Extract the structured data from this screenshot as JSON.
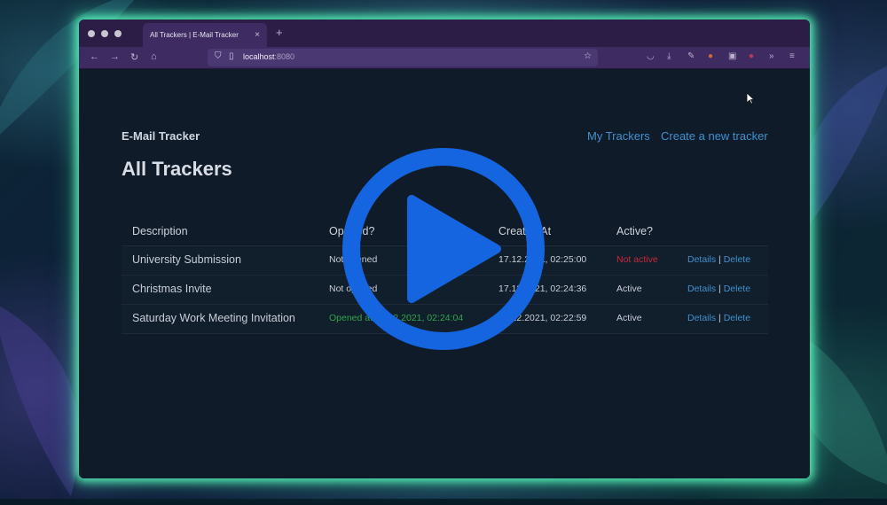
{
  "browser": {
    "tab_title": "All Trackers | E-Mail Tracker",
    "tab_close": "×",
    "new_tab": "+",
    "url_host": "localhost",
    "url_port": ":8080"
  },
  "header": {
    "brand": "E-Mail Tracker",
    "links": [
      "My Trackers",
      "Create a new tracker"
    ]
  },
  "page": {
    "title": "All Trackers"
  },
  "table": {
    "columns": [
      "Description",
      "Opened?",
      "Created At",
      "Active?"
    ],
    "rows": [
      {
        "description": "University Submission",
        "opened": "Not opened",
        "created_at": "17.12.2021, 02:25:00",
        "active": "Not active",
        "details": "Details",
        "delete": "Delete"
      },
      {
        "description": "Christmas Invite",
        "opened": "Not opened",
        "created_at": "17.12.2021, 02:24:36",
        "active": "Active",
        "details": "Details",
        "delete": "Delete"
      },
      {
        "description": "Saturday Work Meeting Invitation",
        "opened": "Opened at 17.12.2021, 02:24:04",
        "created_at": "17.12.2021, 02:22:59",
        "active": "Active",
        "details": "Details",
        "delete": "Delete"
      }
    ],
    "separator": "|"
  },
  "colors": {
    "accent": "#3f91cf",
    "opened": "#2fa64a",
    "inactive": "#c8283b",
    "play": "#1565e0",
    "glow": "#5affbe"
  },
  "icons": [
    "back-icon",
    "forward-icon",
    "reload-icon",
    "home-icon",
    "shield-icon",
    "page-icon",
    "star-icon",
    "pocket-icon",
    "download-icon",
    "wrench-icon",
    "extension-icon",
    "overflow-icon",
    "menu-icon",
    "play-icon",
    "cursor-icon"
  ]
}
